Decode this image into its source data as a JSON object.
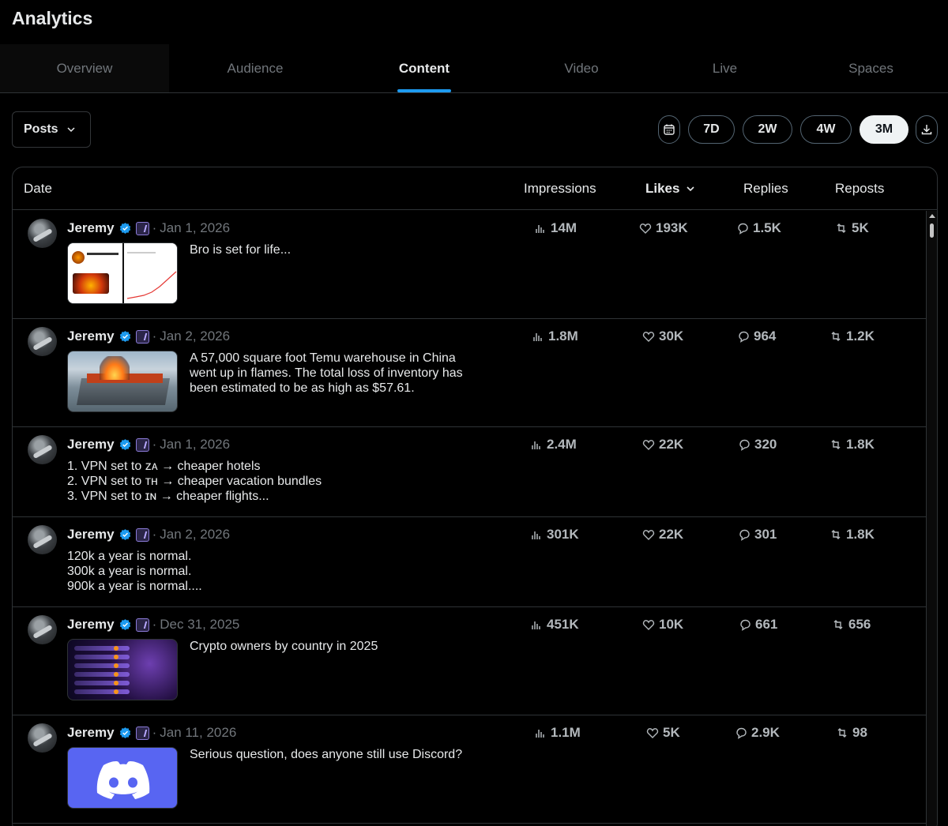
{
  "page": {
    "title": "Analytics"
  },
  "tabs": [
    {
      "label": "Overview",
      "active": false
    },
    {
      "label": "Audience",
      "active": false
    },
    {
      "label": "Content",
      "active": true
    },
    {
      "label": "Video",
      "active": false
    },
    {
      "label": "Live",
      "active": false
    },
    {
      "label": "Spaces",
      "active": false
    }
  ],
  "filters": {
    "type_label": "Posts",
    "ranges": [
      "7D",
      "2W",
      "4W",
      "3M"
    ],
    "active_range": "3M",
    "calendar_icon": "calendar-icon",
    "download_icon": "download-icon"
  },
  "table": {
    "headers": {
      "date": "Date",
      "impressions": "Impressions",
      "likes": "Likes",
      "replies": "Replies",
      "reposts": "Reposts"
    },
    "sorted_by": "likes",
    "rows": [
      {
        "author": "Jeremy",
        "date": "Jan 1, 2026",
        "text": "Bro is set for life...",
        "media": "screenshot-thumbnail",
        "impressions": "14M",
        "likes": "193K",
        "replies": "1.5K",
        "reposts": "5K"
      },
      {
        "author": "Jeremy",
        "date": "Jan 2, 2026",
        "text": "A 57,000 square foot Temu warehouse in China\nwent up in flames. The total loss of inventory has\nbeen estimated to be as high as $57.61.",
        "media": "warehouse-fire-photo",
        "impressions": "1.8M",
        "likes": "30K",
        "replies": "964",
        "reposts": "1.2K"
      },
      {
        "author": "Jeremy",
        "date": "Jan 1, 2026",
        "text": "1. VPN set to ᴢᴀ → cheaper hotels\n2. VPN set to ᴛʜ → cheaper vacation bundles\n3. VPN set to ɪɴ → cheaper flights...",
        "media": null,
        "impressions": "2.4M",
        "likes": "22K",
        "replies": "320",
        "reposts": "1.8K"
      },
      {
        "author": "Jeremy",
        "date": "Jan 2, 2026",
        "text": "120k a year is normal.\n300k a year is normal.\n900k a year is normal....",
        "media": null,
        "impressions": "301K",
        "likes": "22K",
        "replies": "301",
        "reposts": "1.8K"
      },
      {
        "author": "Jeremy",
        "date": "Dec 31, 2025",
        "text": "Crypto owners by country in 2025",
        "media": "crypto-chart-image",
        "impressions": "451K",
        "likes": "10K",
        "replies": "661",
        "reposts": "656"
      },
      {
        "author": "Jeremy",
        "date": "Jan 11, 2026",
        "text": "Serious question, does anyone still use Discord?",
        "media": "discord-logo-image",
        "impressions": "1.1M",
        "likes": "5K",
        "replies": "2.9K",
        "reposts": "98"
      }
    ]
  },
  "colors": {
    "background": "#000000",
    "accent": "#1d9bf0",
    "border": "#2f3336",
    "muted": "#71767b",
    "discord": "#5865f2"
  }
}
